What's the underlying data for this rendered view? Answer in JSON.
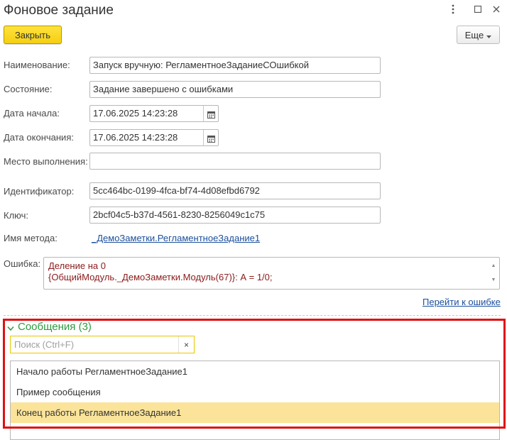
{
  "window": {
    "title": "Фоновое задание",
    "menu_icon": "kebab-menu-icon",
    "maximize_icon": "maximize-icon",
    "close_icon": "close-icon"
  },
  "toolbar": {
    "close_label": "Закрыть",
    "more_label": "Еще",
    "more_icon": "dropdown-triangle-icon"
  },
  "fields": {
    "name": {
      "label": "Наименование:",
      "value": "Запуск вручную: РегламентноеЗаданиеСОшибкой"
    },
    "state": {
      "label": "Состояние:",
      "value": "Задание завершено с ошибками"
    },
    "start_date": {
      "label": "Дата начала:",
      "value": "17.06.2025 14:23:28"
    },
    "end_date": {
      "label": "Дата окончания:",
      "value": "17.06.2025 14:23:28"
    },
    "location": {
      "label": "Место выполнения:",
      "value": ""
    },
    "identifier": {
      "label": "Идентификатор:",
      "value": "5cc464bc-0199-4fca-bf74-4d08efbd6792"
    },
    "key": {
      "label": "Ключ:",
      "value": "2bcf04c5-b37d-4561-8230-8256049c1c75"
    },
    "method": {
      "label": "Имя метода:",
      "value": "_ДемоЗаметки.РегламентноеЗадание1"
    },
    "error": {
      "label": "Ошибка:",
      "line1": "Деление на 0",
      "line2": "{ОбщийМодуль._ДемоЗаметки.Модуль(67)}: А = 1/0;"
    }
  },
  "goto_error_link": "Перейти к ошибке",
  "messages": {
    "group_title": "Сообщения (3)",
    "search_placeholder": "Поиск (Ctrl+F)",
    "search_value": "",
    "clear_label": "×",
    "items": [
      {
        "text": "Начало работы РегламентноеЗадание1",
        "selected": false
      },
      {
        "text": "Пример сообщения",
        "selected": false
      },
      {
        "text": "Конец работы РегламентноеЗадание1",
        "selected": true
      }
    ]
  },
  "colors": {
    "accent_button": "#f5cf13",
    "group_title": "#2e9b3f",
    "error_text": "#8b1a1a",
    "link": "#1b4f9c",
    "selected_row": "#fbe49a",
    "highlight_frame": "#e01010"
  }
}
